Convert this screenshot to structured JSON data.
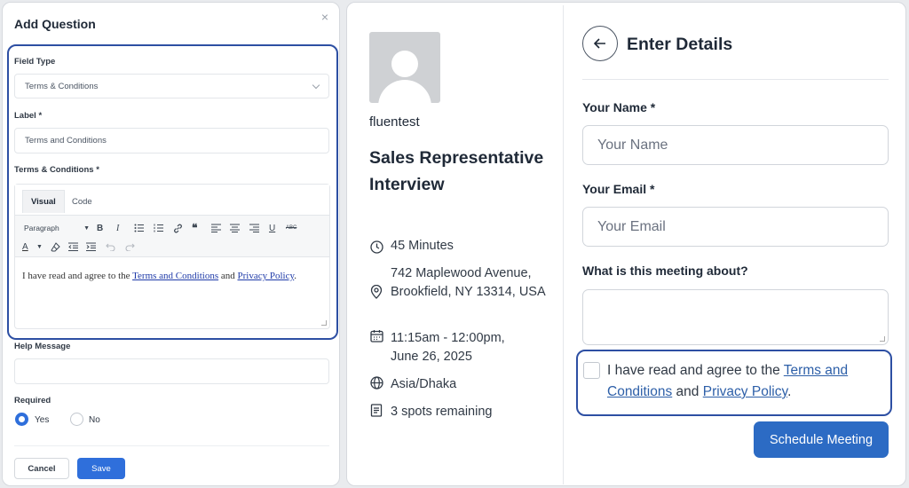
{
  "modal": {
    "title": "Add Question",
    "close_glyph": "×",
    "field_type_label": "Field Type",
    "field_type_value": "Terms & Conditions",
    "label_label": "Label *",
    "label_value": "Terms and Conditions",
    "terms_label": "Terms & Conditions *",
    "editor": {
      "tabs": [
        "Visual",
        "Code"
      ],
      "paragraph_select": "Paragraph",
      "body_pre": "I have read and agree to the ",
      "link1": "Terms and Conditions",
      "body_mid": " and ",
      "link2": "Privacy Policy",
      "body_post": "."
    },
    "help_label": "Help Message",
    "help_value": "",
    "required_label": "Required",
    "required_options": [
      "Yes",
      "No"
    ],
    "required_selected": "Yes",
    "cancel_label": "Cancel",
    "save_label": "Save",
    "accent_color": "#2f6fdb"
  },
  "booking": {
    "host": "fluentest",
    "event_title": "Sales Representative Interview",
    "duration": "45 Minutes",
    "location": "742 Maplewood Avenue, Brookfield, NY 13314, USA",
    "time": "11:15am - 12:00pm, June 26, 2025",
    "timezone": "Asia/Dhaka",
    "spots": "3 spots remaining",
    "heading": "Enter Details",
    "name_label": "Your Name *",
    "name_placeholder": "Your Name",
    "email_label": "Your Email *",
    "email_placeholder": "Your Email",
    "about_label": "What is this meeting about?",
    "terms_pre": "I have read and agree to the ",
    "terms_link": "Terms and Conditions",
    "terms_mid": " and ",
    "privacy_link": "Privacy Policy",
    "terms_post": ".",
    "schedule_label": "Schedule Meeting",
    "button_color": "#2c6bc4"
  },
  "highlight_color": "#2d4fa3",
  "icons": [
    "clock-icon",
    "location-pin-icon",
    "calendar-icon",
    "globe-icon",
    "document-icon",
    "back-arrow-icon"
  ]
}
